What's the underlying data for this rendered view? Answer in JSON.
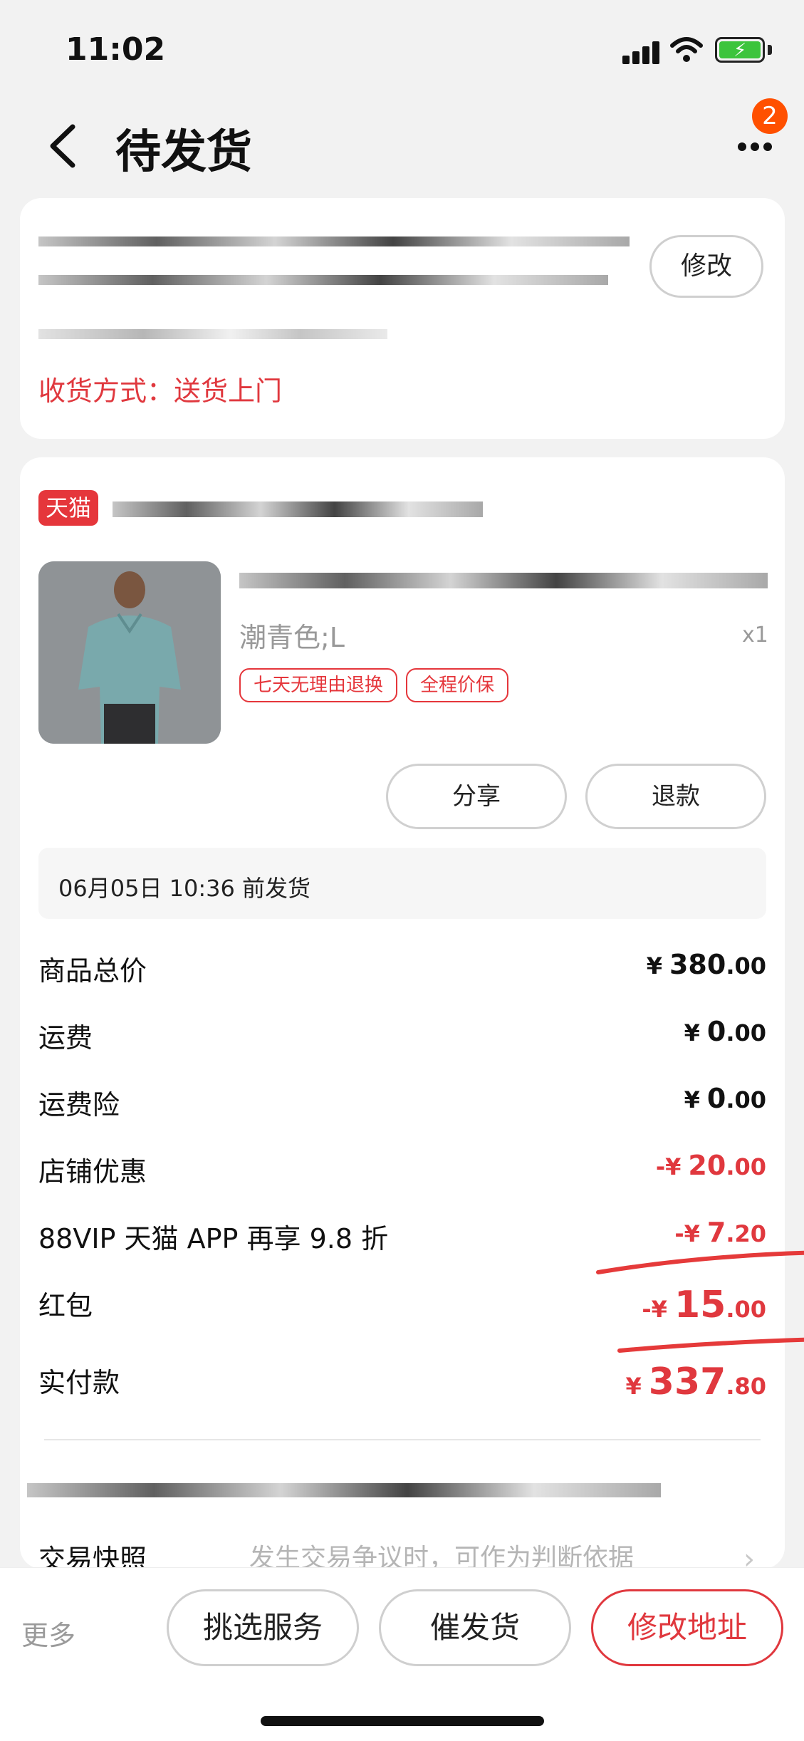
{
  "status_bar": {
    "time": "11:02"
  },
  "nav": {
    "title": "待发货",
    "badge_count": "2"
  },
  "address_card": {
    "modify_label": "修改",
    "delivery_method": "收货方式：送货上门"
  },
  "shop": {
    "platform_tag": "天猫"
  },
  "product": {
    "variant": "潮青色;L",
    "quantity": "x1",
    "tags": [
      "七天无理由退换",
      "全程价保"
    ],
    "share_label": "分享",
    "refund_label": "退款"
  },
  "shipping": {
    "deadline": "06月05日 10:36 前发货"
  },
  "price_rows": [
    {
      "label": "商品总价",
      "currency": "¥",
      "int": "380",
      "dec": ".00",
      "color": "#111111"
    },
    {
      "label": "运费",
      "currency": "¥",
      "int": "0",
      "dec": ".00",
      "color": "#111111"
    },
    {
      "label": "运费险",
      "currency": "¥",
      "int": "0",
      "dec": ".00",
      "color": "#111111"
    },
    {
      "label": "店铺优惠",
      "currency": "-¥",
      "int": "20",
      "dec": ".00",
      "color": "#e0383e"
    },
    {
      "label": "88VIP 天猫 APP 再享 9.8 折",
      "currency": "-¥",
      "int": "7",
      "dec": ".20",
      "color": "#e0383e"
    },
    {
      "label": "红包",
      "currency": "-¥",
      "int": "15",
      "dec": ".00",
      "color": "#e0383e"
    },
    {
      "label": "实付款",
      "currency": "¥",
      "int": "337",
      "dec": ".80",
      "color": "#e0383e"
    }
  ],
  "snapshot": {
    "label": "交易快照",
    "description": "发生交易争议时，可作为判断依据",
    "chevron": "›"
  },
  "bottom_bar": {
    "more": "更多",
    "select_service": "挑选服务",
    "urge_shipping": "催发货",
    "modify_address": "修改地址"
  },
  "colors": {
    "accent_red": "#e0383e",
    "badge_orange": "#ff5000",
    "tmall_red": "#e5363b"
  },
  "icons": [
    "back-arrow-icon",
    "more-dots-icon",
    "signal-icon",
    "wifi-icon",
    "battery-icon",
    "chevron-right-icon"
  ]
}
